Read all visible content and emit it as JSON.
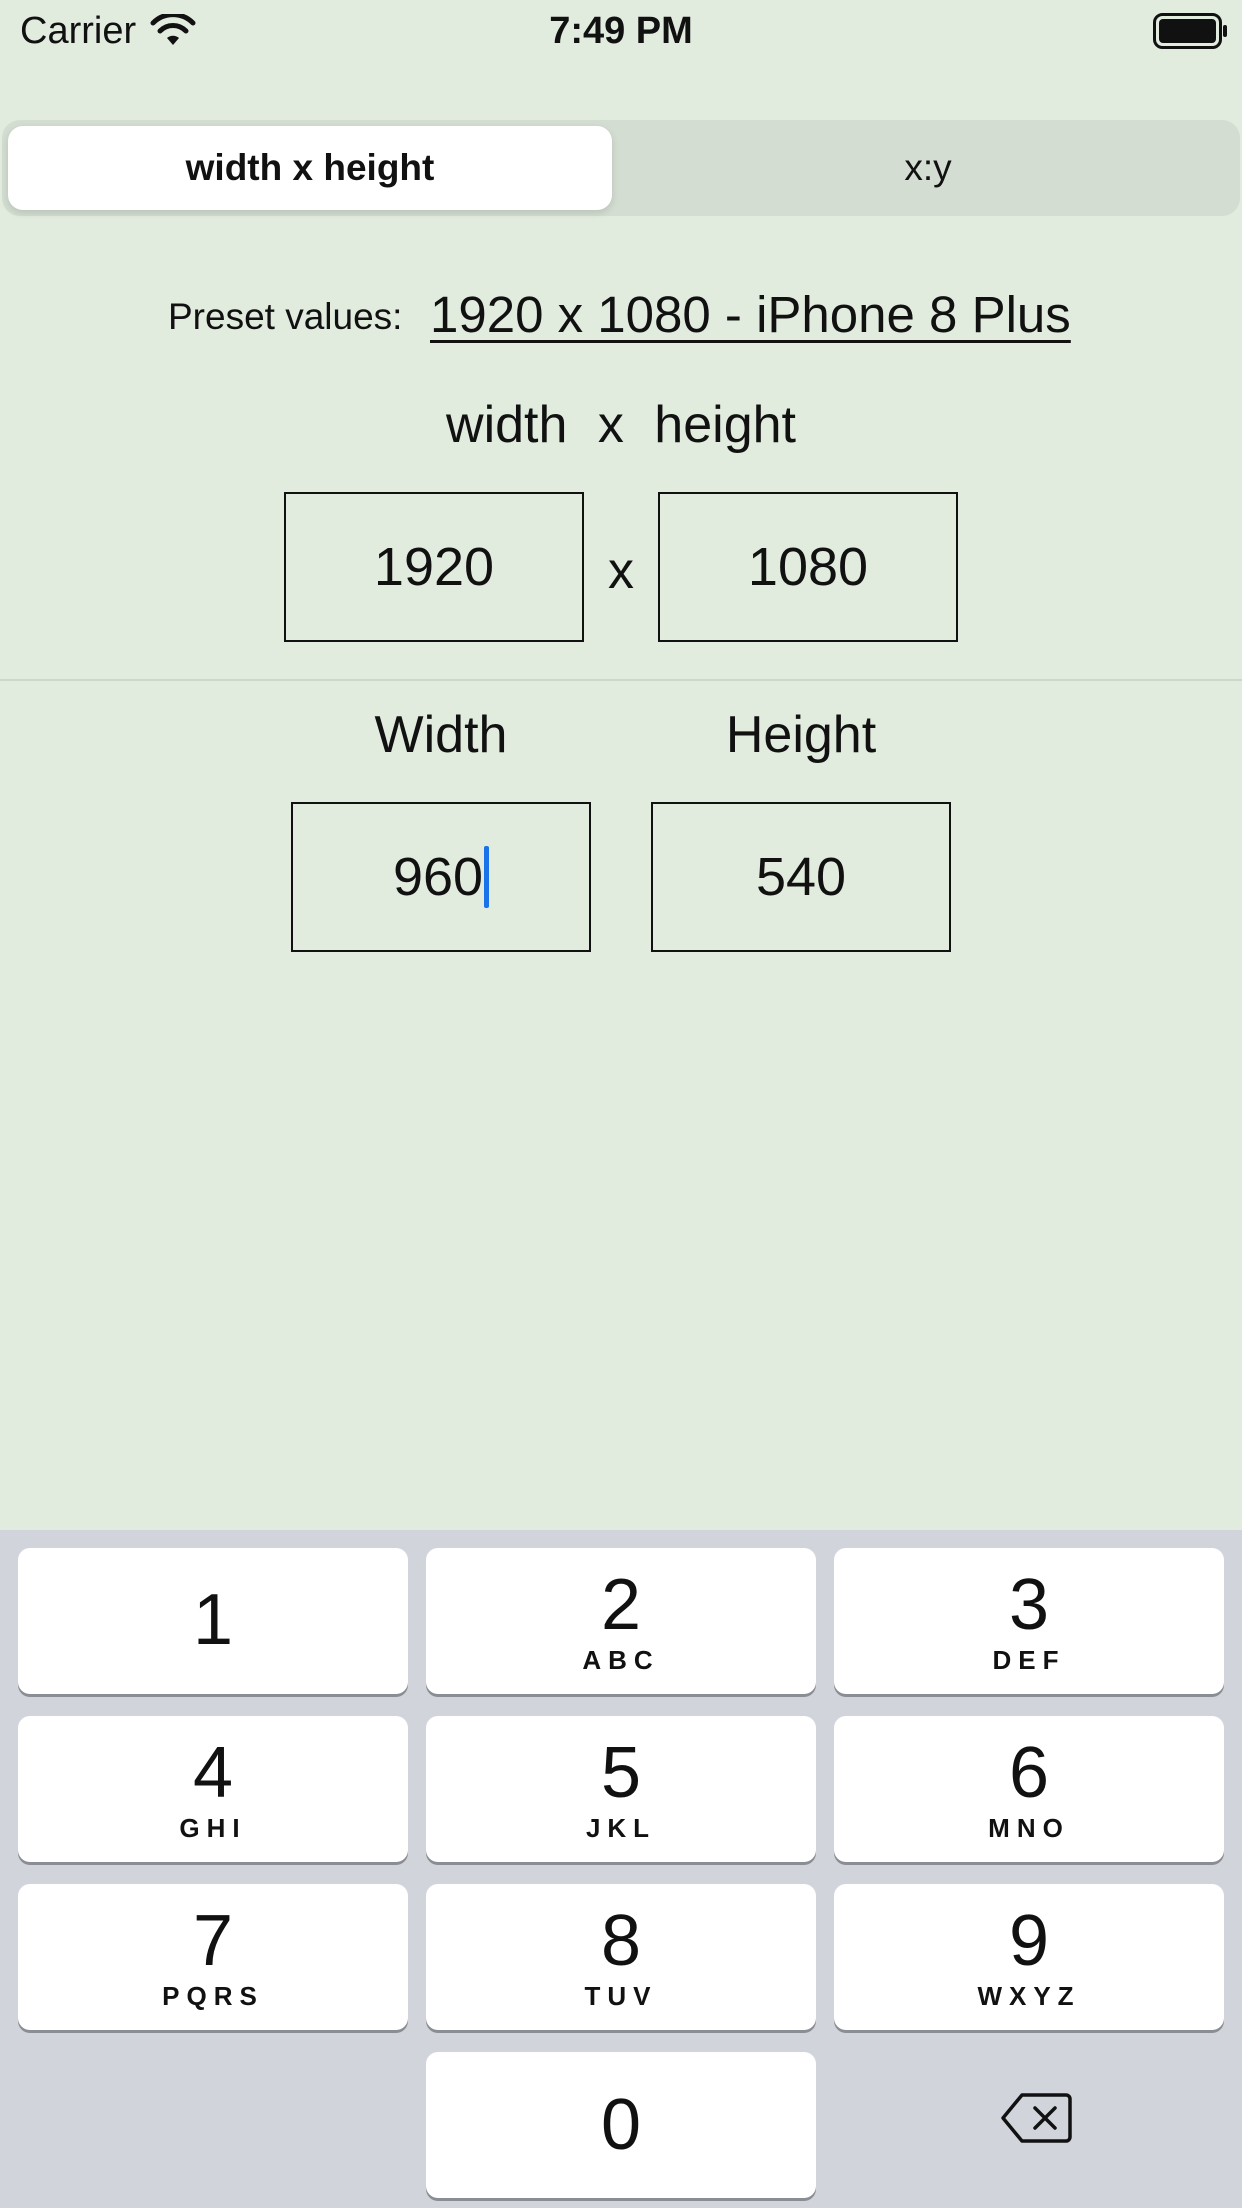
{
  "status_bar": {
    "carrier": "Carrier",
    "time": "7:49 PM",
    "wifi_icon": "wifi-icon",
    "battery_icon": "battery-icon"
  },
  "segmented": {
    "items": [
      {
        "label": "width x height",
        "selected": true
      },
      {
        "label": "x:y",
        "selected": false
      }
    ]
  },
  "preset": {
    "label": "Preset values:",
    "value": "1920 x 1080 - iPhone 8 Plus"
  },
  "ratio": {
    "header": "width x height",
    "width": "1920",
    "separator": "x",
    "height": "1080"
  },
  "resize": {
    "width_label": "Width",
    "height_label": "Height",
    "width": "960",
    "height": "540"
  },
  "keypad": {
    "keys": [
      {
        "num": "1",
        "letters": ""
      },
      {
        "num": "2",
        "letters": "ABC"
      },
      {
        "num": "3",
        "letters": "DEF"
      },
      {
        "num": "4",
        "letters": "GHI"
      },
      {
        "num": "5",
        "letters": "JKL"
      },
      {
        "num": "6",
        "letters": "MNO"
      },
      {
        "num": "7",
        "letters": "PQRS"
      },
      {
        "num": "8",
        "letters": "TUV"
      },
      {
        "num": "9",
        "letters": "WXYZ"
      },
      {
        "num": "0",
        "letters": ""
      }
    ],
    "delete_icon": "delete-backspace-icon"
  },
  "colors": {
    "background": "#e1ecdf",
    "keypad_bg": "#d1d5db",
    "caret": "#1a73e8"
  }
}
